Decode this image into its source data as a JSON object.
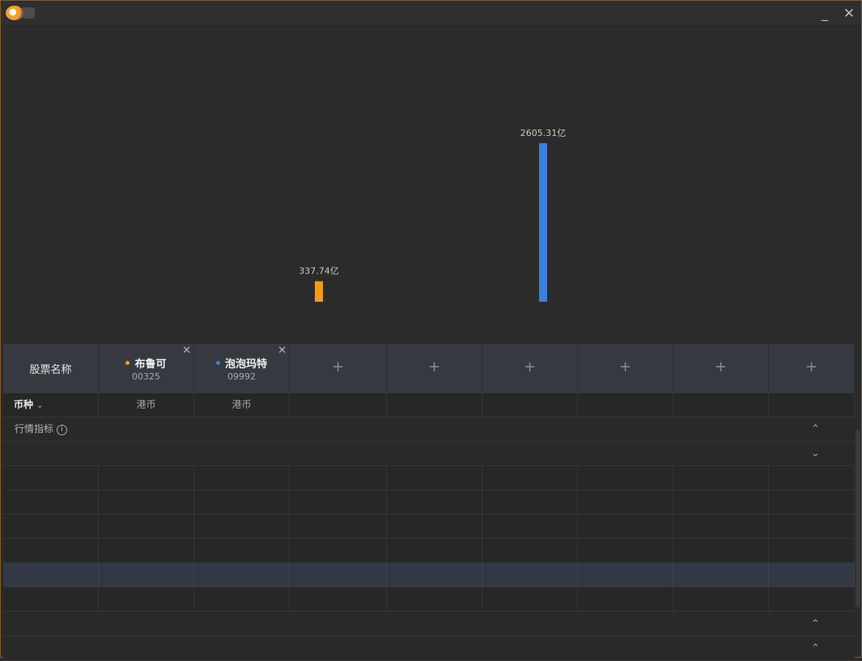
{
  "window": {
    "min_glyph": "_",
    "close_glyph": "✕",
    "border_color": "#8a5a2b"
  },
  "chart_data": {
    "type": "bar",
    "categories": [
      "布鲁可",
      "泡泡玛特"
    ],
    "values": [
      337.74,
      2605.31
    ],
    "value_labels": [
      "337.74亿",
      "2605.31亿"
    ],
    "colors": [
      "#f39c12",
      "#3d7fdc"
    ],
    "ylim": [
      0,
      2605.31
    ],
    "grid": false,
    "title": "",
    "xlabel": "",
    "ylabel": ""
  },
  "table": {
    "header_label": "股票名称",
    "stocks": [
      {
        "name": "布鲁可",
        "code": "00325",
        "color": "#f39c12",
        "close": "✕"
      },
      {
        "name": "泡泡玛特",
        "code": "09992",
        "color": "#3d7fdc",
        "close": "✕"
      }
    ],
    "add_slot_glyph": "+",
    "add_slots": 6,
    "currency_label": "币种",
    "currency_chevron": "⌄",
    "currency_values": [
      "港币",
      "港币"
    ],
    "section_label": "行情指标",
    "info_glyph": "i",
    "collapse_glyph": "⌃",
    "expand_glyph": "⌄"
  }
}
